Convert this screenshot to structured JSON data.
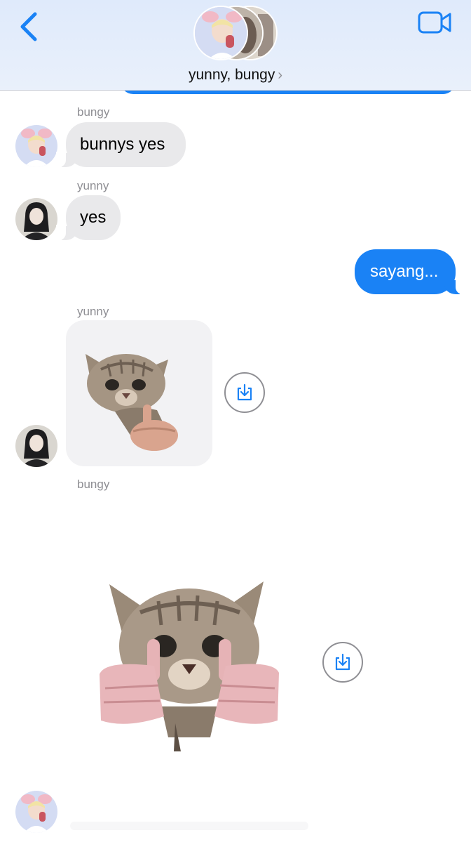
{
  "header": {
    "title": "yunny, bungy",
    "chevron": "›",
    "back_icon": "chevron-left-icon",
    "video_icon": "video-camera-icon"
  },
  "messages": [
    {
      "sender": "bungy",
      "text": "bunnys yes",
      "direction": "incoming"
    },
    {
      "sender": "yunny",
      "text": "yes",
      "direction": "incoming"
    },
    {
      "text": "sayang...",
      "direction": "outgoing"
    },
    {
      "sender": "yunny",
      "type": "sticker",
      "sticker": "kitten-middle-finger",
      "direction": "incoming"
    },
    {
      "sender": "bungy",
      "type": "sticker",
      "sticker": "kitten-double-middle-finger",
      "direction": "incoming"
    }
  ],
  "colors": {
    "accent": "#1a82f5",
    "incoming_bubble": "#e9e9eb",
    "sender_label": "#8e8e93"
  }
}
